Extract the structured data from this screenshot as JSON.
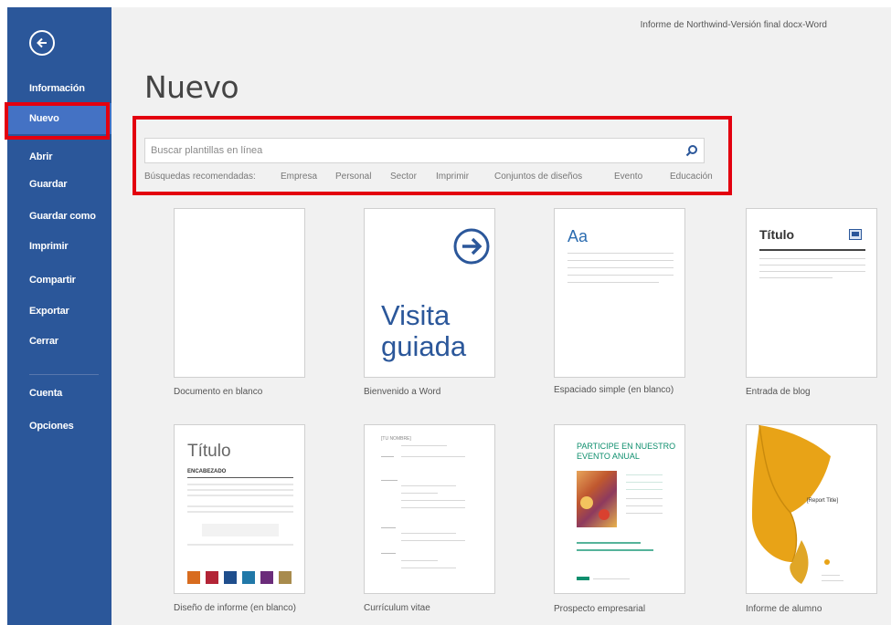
{
  "window": {
    "title": "Informe de Northwind-Versión final docx-Word"
  },
  "sidebar": {
    "back_icon": "arrow-left-circle-icon",
    "items": [
      {
        "label": "Información"
      },
      {
        "label": "Nuevo"
      },
      {
        "label": "Abrir"
      },
      {
        "label": "Guardar"
      },
      {
        "label": "Guardar como"
      },
      {
        "label": "Imprimir"
      },
      {
        "label": "Compartir"
      },
      {
        "label": "Exportar"
      },
      {
        "label": "Cerrar"
      },
      {
        "label": "Cuenta"
      },
      {
        "label": "Opciones"
      }
    ]
  },
  "main": {
    "title": "Nuevo",
    "search": {
      "placeholder": "Buscar plantillas en línea",
      "icon": "search-icon"
    },
    "suggestions": [
      "Búsquedas recomendadas:",
      "Empresa",
      "Personal",
      "Sector",
      "Imprimir",
      "Conjuntos de diseños",
      "Evento",
      "Educación"
    ],
    "templates": [
      {
        "label": "Documento en blanco"
      },
      {
        "label": "Bienvenido a Word",
        "heading_line1": "Visita",
        "heading_line2": "guiada",
        "icon": "arrow-right-circle-icon"
      },
      {
        "label": "Espaciado simple (en blanco)",
        "heading": "Aa"
      },
      {
        "label": "Entrada de blog",
        "heading": "Título",
        "icon": "image-icon"
      },
      {
        "label": "Diseño de informe (en blanco)",
        "heading": "Título",
        "subheading": "ENCABEZADO"
      },
      {
        "label": "Currículum vitae",
        "heading": "[TU NOMBRE]"
      },
      {
        "label": "Prospecto empresarial",
        "heading_line1": "PARTICIPE EN NUESTRO",
        "heading_line2": "EVENTO ANUAL"
      },
      {
        "label": "Informe de alumno",
        "heading": "[Report Title]"
      }
    ]
  },
  "colors": {
    "sidebar": "#2b579a",
    "sidebar_active": "#4472c4",
    "highlight": "#e3000f",
    "accent_blue": "#2b579a",
    "flyer_green": "#0f8f6e",
    "butterfly_yellow": "#e8a317"
  }
}
